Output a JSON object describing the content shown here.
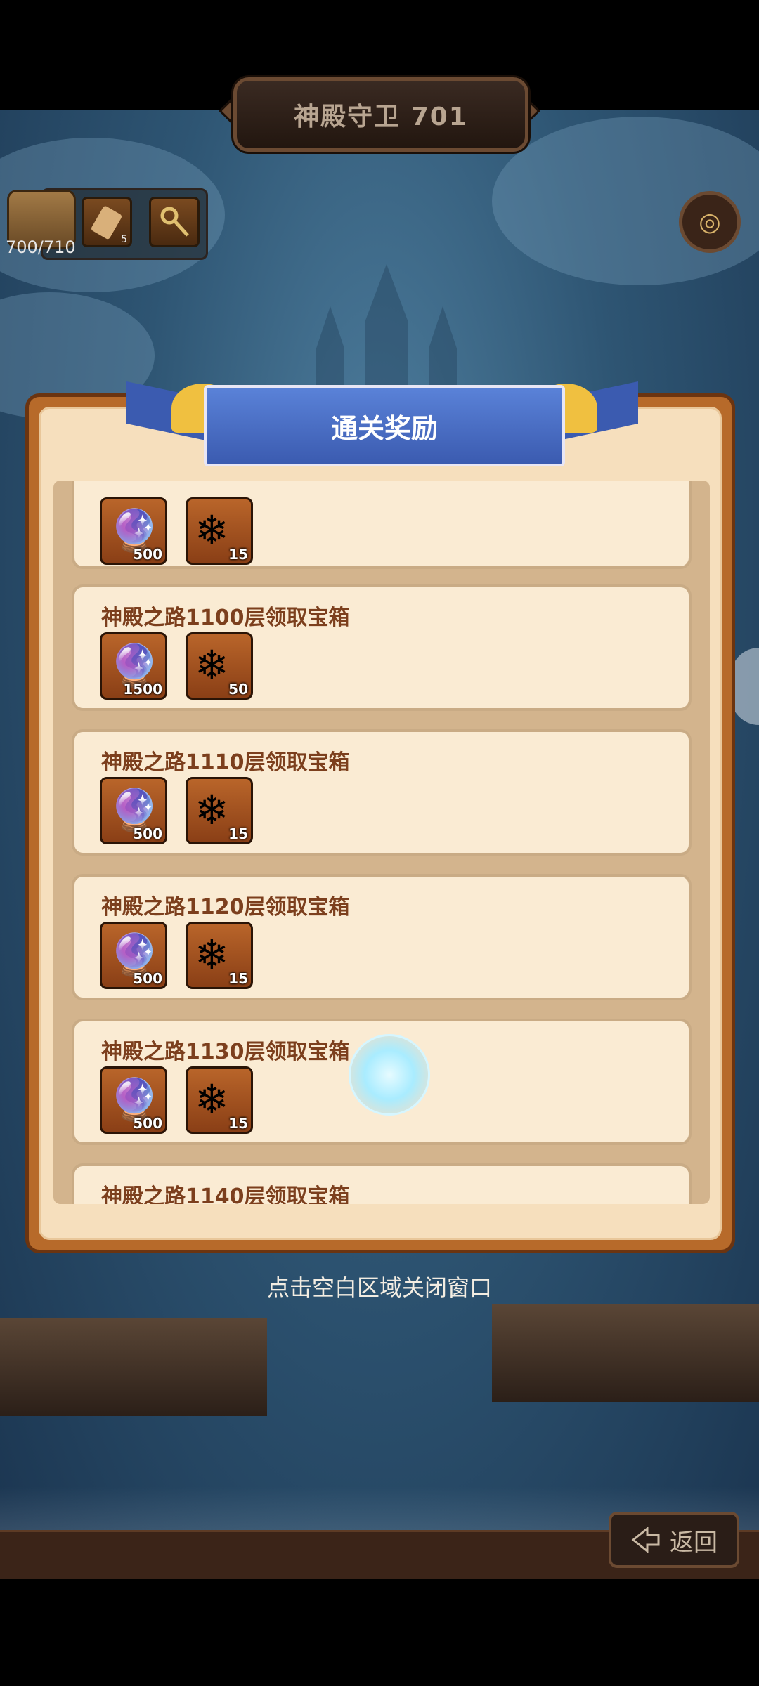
{
  "header": {
    "title": "神殿守卫 701"
  },
  "resources": {
    "chest_count": "700/710",
    "slot_1_count": "5"
  },
  "panel": {
    "title": "通关奖励"
  },
  "rewards": [
    {
      "title": "",
      "items": [
        {
          "icon": "scroll-eye-icon",
          "qty": "500"
        },
        {
          "icon": "blue-crystal-icon",
          "qty": "15"
        }
      ]
    },
    {
      "title": "神殿之路1100层领取宝箱",
      "items": [
        {
          "icon": "scroll-eye-icon",
          "qty": "1500"
        },
        {
          "icon": "blue-crystal-icon",
          "qty": "50"
        }
      ]
    },
    {
      "title": "神殿之路1110层领取宝箱",
      "items": [
        {
          "icon": "scroll-eye-icon",
          "qty": "500"
        },
        {
          "icon": "blue-crystal-icon",
          "qty": "15"
        }
      ]
    },
    {
      "title": "神殿之路1120层领取宝箱",
      "items": [
        {
          "icon": "scroll-eye-icon",
          "qty": "500"
        },
        {
          "icon": "blue-crystal-icon",
          "qty": "15"
        }
      ]
    },
    {
      "title": "神殿之路1130层领取宝箱",
      "items": [
        {
          "icon": "scroll-eye-icon",
          "qty": "500"
        },
        {
          "icon": "blue-crystal-icon",
          "qty": "15"
        }
      ]
    },
    {
      "title": "神殿之路1140层领取宝箱",
      "items": []
    }
  ],
  "hint": "点击空白区域关闭窗口",
  "back_button": "返回",
  "colors": {
    "panel_border": "#b76a2a",
    "ribbon": "#3b5bb0",
    "card_title": "#7c3f1d"
  }
}
